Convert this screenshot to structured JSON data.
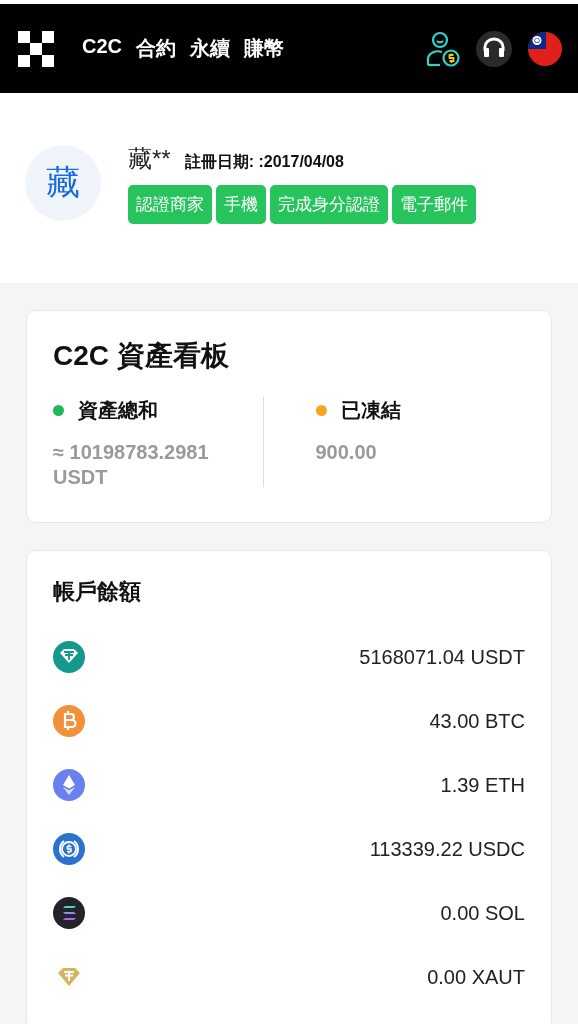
{
  "header": {
    "nav": [
      "C2C",
      "合約",
      "永續",
      "賺幣"
    ]
  },
  "profile": {
    "avatar": "藏",
    "name": "藏**",
    "registered": "註冊日期: :2017/04/08",
    "tags": [
      "認證商家",
      "手機",
      "完成身分認證",
      "電子郵件"
    ]
  },
  "asset_board": {
    "title": "C2C 資產看板",
    "stats": [
      {
        "label": "資產總和",
        "value": "≈ 10198783.2981 USDT",
        "color": "#22b85a"
      },
      {
        "label": "已凍結",
        "value": "900.00",
        "color": "#f5a623"
      }
    ]
  },
  "balances": {
    "title": "帳戶餘額",
    "items": [
      {
        "kind": "usdt",
        "amount": "5168071.04 USDT"
      },
      {
        "kind": "btc",
        "amount": "43.00 BTC"
      },
      {
        "kind": "eth",
        "amount": "1.39 ETH"
      },
      {
        "kind": "usdc",
        "amount": "113339.22 USDC"
      },
      {
        "kind": "sol",
        "amount": "0.00 SOL"
      },
      {
        "kind": "xaut",
        "amount": "0.00 XAUT"
      }
    ]
  }
}
